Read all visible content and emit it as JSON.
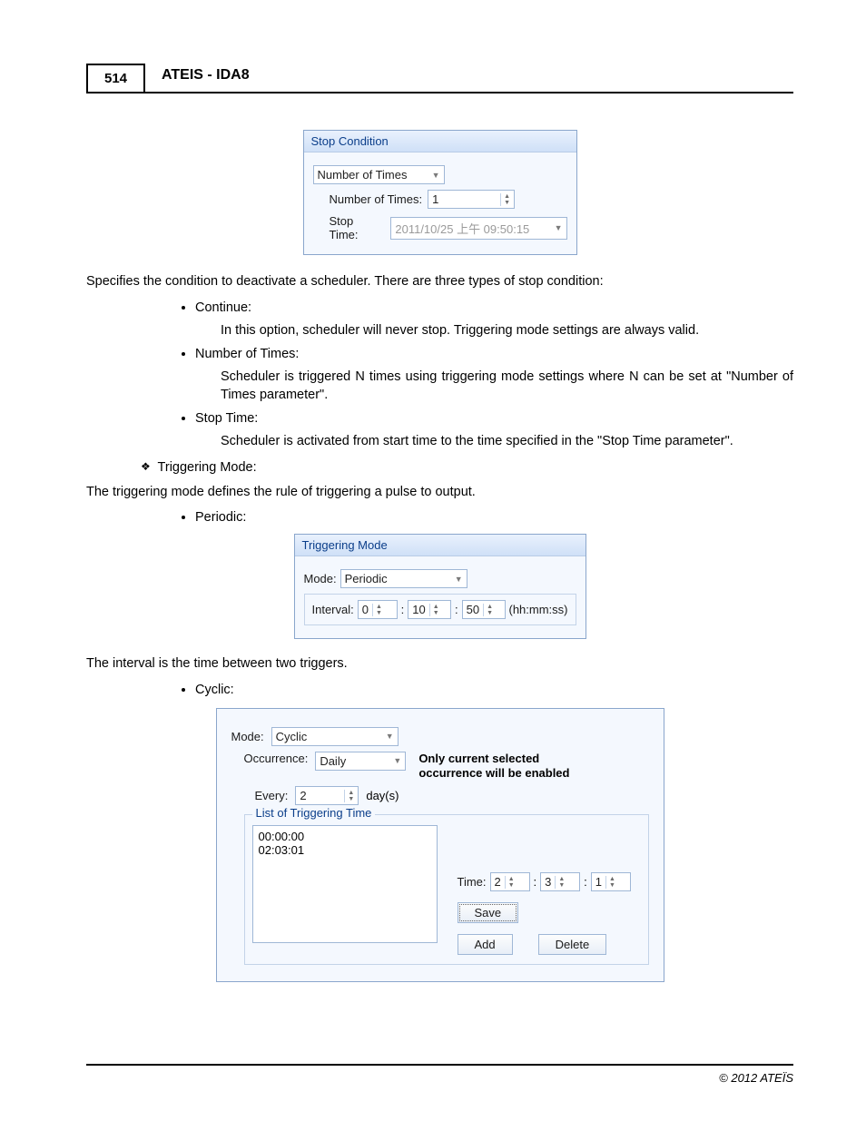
{
  "header": {
    "page_number": "514",
    "title": "ATEIS - IDA8"
  },
  "stop_panel": {
    "title": "Stop Condition",
    "type_value": "Number of Times",
    "count_label": "Number of Times:",
    "count_value": "1",
    "stop_time_label": "Stop Time:",
    "stop_time_value": "2011/10/25 上午 09:50:15"
  },
  "body": {
    "intro": "Specifies the condition to deactivate a scheduler. There are three types of stop condition:",
    "b1": "Continue:",
    "b1_sub": "In this option, scheduler will never stop. Triggering mode settings are always valid.",
    "b2": "Number of Times:",
    "b2_sub": "Scheduler is triggered N times using  triggering mode settings where N can be set at \"Number of Times parameter\".",
    "b3": "Stop Time:",
    "b3_sub": "Scheduler is activated from start time to the time specified in the \"Stop Time parameter\".",
    "trig_heading": "Triggering Mode:",
    "trig_desc": "The triggering mode defines the rule of triggering a pulse to output.",
    "periodic_label": "Periodic:",
    "periodic_sub": "The interval is the time between two triggers.",
    "cyclic_label": "Cyclic:"
  },
  "periodic_panel": {
    "title": "Triggering Mode",
    "mode_label": "Mode:",
    "mode_value": "Periodic",
    "interval_label": "Interval:",
    "hh": "0",
    "mm": "10",
    "ss": "50",
    "unit": "(hh:mm:ss)"
  },
  "cyclic_panel": {
    "mode_label": "Mode:",
    "mode_value": "Cyclic",
    "occurrence_label": "Occurrence:",
    "occurrence_value": "Daily",
    "notice": "Only current selected occurrence will be enabled",
    "every_label": "Every:",
    "every_value": "2",
    "every_unit": "day(s)",
    "list_title": "List of Triggering Time",
    "list_items": [
      "00:00:00",
      "02:03:01"
    ],
    "time_label": "Time:",
    "th": "2",
    "tm": "3",
    "ts": "1",
    "save": "Save",
    "add": "Add",
    "delete": "Delete"
  },
  "footer": "© 2012 ATEÏS"
}
